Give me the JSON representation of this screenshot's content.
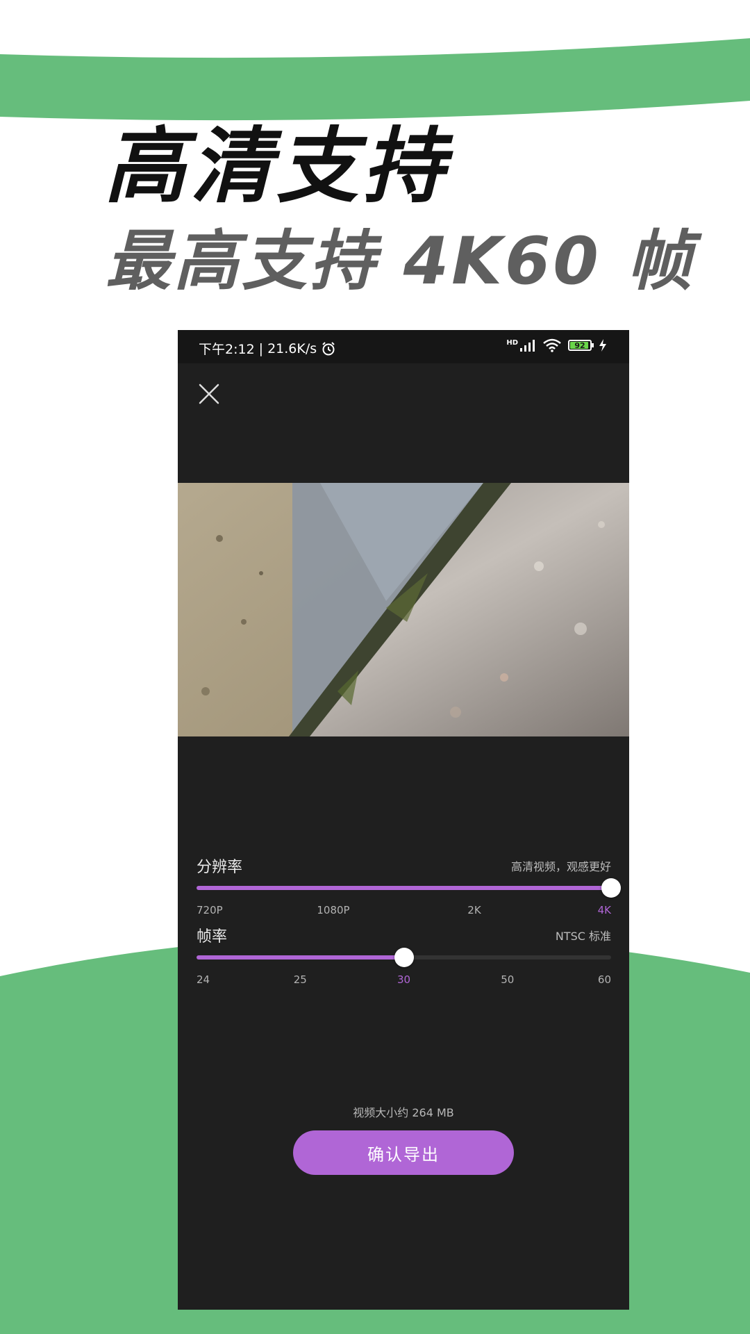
{
  "promo": {
    "headline": "高清支持",
    "subline": "最高支持 4K60 帧",
    "accent_color": "#66bd7c"
  },
  "status_bar": {
    "time": "下午2:12",
    "separator": "|",
    "speed": "21.6K/s",
    "alarm_icon": "alarm-clock-icon",
    "network_label": "HD",
    "signal_icon": "cellular-signal-icon",
    "wifi_icon": "wifi-icon",
    "battery_level": "92",
    "battery_fraction": 0.92,
    "charging_icon": "lightning-bolt-icon"
  },
  "screen": {
    "close_icon": "close-icon",
    "resolution": {
      "label": "分辨率",
      "hint": "高清视频，观感更好",
      "options": [
        "720P",
        "1080P",
        "2K",
        "4K"
      ],
      "selected_index": 3,
      "value_fraction": 1.0
    },
    "frame_rate": {
      "label": "帧率",
      "hint": "NTSC 标准",
      "options": [
        "24",
        "25",
        "30",
        "50",
        "60"
      ],
      "selected_index": 2,
      "value_fraction": 0.5
    },
    "size_text": "视频大小约 264 MB",
    "export_button": "确认导出",
    "accent_color": "#b066d6"
  }
}
